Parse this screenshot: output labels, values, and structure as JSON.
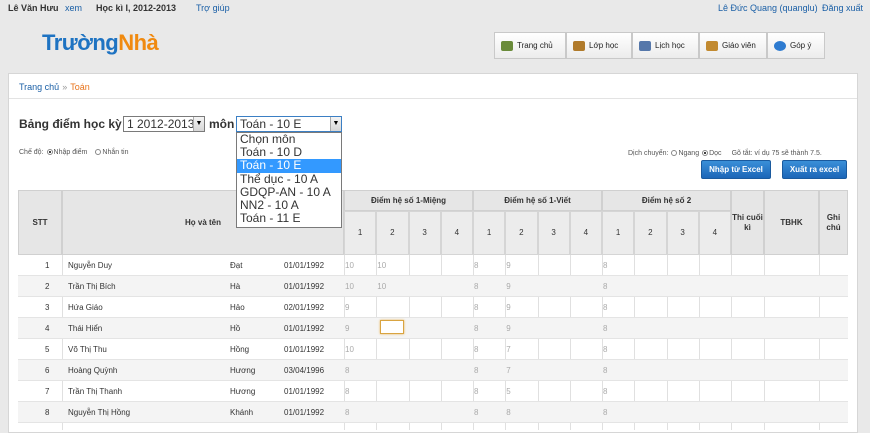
{
  "top": {
    "user": "Lê Văn Hưu",
    "view": "xem",
    "term": "Học kì I, 2012-2013",
    "help": "Trợ giúp",
    "account": "Lê Đức Quang (quanglu)",
    "logout": "Đăng xuất"
  },
  "logo": {
    "part1": "Trường",
    "part2": "Nhà"
  },
  "nav": [
    {
      "label": "Trang chủ",
      "icon": "home-icon",
      "color": "#6a8b3a"
    },
    {
      "label": "Lớp học",
      "icon": "class-icon",
      "color": "#b07a2a"
    },
    {
      "label": "Lịch học",
      "icon": "calendar-icon",
      "color": "#5577aa"
    },
    {
      "label": "Giáo viên",
      "icon": "teacher-icon",
      "color": "#c28a30"
    },
    {
      "label": "Góp ý",
      "icon": "feedback-icon",
      "color": "#2e7bd0"
    }
  ],
  "breadcrumb": {
    "home": "Trang chủ",
    "sep": "»",
    "current": "Toán"
  },
  "form": {
    "title": "Bảng điểm học kỳ",
    "term_value": "1 2012-2013",
    "subject_label": "môn",
    "subject_value": "Toán - 10 E"
  },
  "dropdown": {
    "options": [
      "Chọn môn",
      "Toán - 10 D",
      "Toán - 10 E",
      "Thể dục - 10 A",
      "GDQP-AN - 10 A",
      "NN2 - 10 A",
      "Toán - 11 E"
    ],
    "selected": "Toán - 10 E"
  },
  "mode": {
    "label": "Chế độ:",
    "enter": "Nhập điểm",
    "message": "Nhắn tin",
    "selected": "Nhập điểm"
  },
  "direction": {
    "label": "Dịch chuyển:",
    "horizontal": "Ngang",
    "vertical": "Dọc",
    "selected": "Dọc"
  },
  "hint": "Gõ tắt: ví dụ 75 sẽ thành 7.5.",
  "buttons": {
    "import": "Nhập từ Excel",
    "export": "Xuất ra excel"
  },
  "accent": "#2a7ccc",
  "table": {
    "headers": {
      "stt": "STT",
      "name": "Họ và tên",
      "oral": "Điểm hệ số 1-Miệng",
      "written": "Điểm hệ số 1-Viết",
      "coef2": "Điểm hệ số 2",
      "final": "Thi cuối kì",
      "avg": "TBHK",
      "note": "Ghi chú"
    },
    "subcols": [
      "1",
      "2",
      "3",
      "4"
    ],
    "rows": [
      {
        "stt": "1",
        "last": "Nguyễn Duy",
        "first": "Đạt",
        "dob": "01/01/1992",
        "m": [
          "10",
          "10",
          "",
          ""
        ],
        "v": [
          "8",
          "9",
          "",
          ""
        ],
        "c": [
          "8",
          "",
          "",
          ""
        ]
      },
      {
        "stt": "2",
        "last": "Trần Thị Bích",
        "first": "Hà",
        "dob": "01/01/1992",
        "m": [
          "10",
          "10",
          "",
          ""
        ],
        "v": [
          "8",
          "9",
          "",
          ""
        ],
        "c": [
          "8",
          "",
          "",
          ""
        ]
      },
      {
        "stt": "3",
        "last": "Hứa Giáo",
        "first": "Hảo",
        "dob": "02/01/1992",
        "m": [
          "9",
          "",
          "",
          ""
        ],
        "v": [
          "8",
          "9",
          "",
          ""
        ],
        "c": [
          "8",
          "",
          "",
          ""
        ]
      },
      {
        "stt": "4",
        "last": "Thái Hiển",
        "first": "Hồ",
        "dob": "01/01/1992",
        "m": [
          "9",
          "",
          "",
          ""
        ],
        "v": [
          "8",
          "9",
          "",
          ""
        ],
        "c": [
          "8",
          "",
          "",
          ""
        ]
      },
      {
        "stt": "5",
        "last": "Võ Thị Thu",
        "first": "Hồng",
        "dob": "01/01/1992",
        "m": [
          "10",
          "",
          "",
          ""
        ],
        "v": [
          "8",
          "7",
          "",
          ""
        ],
        "c": [
          "8",
          "",
          "",
          ""
        ]
      },
      {
        "stt": "6",
        "last": "Hoàng Quỳnh",
        "first": "Hương",
        "dob": "03/04/1996",
        "m": [
          "8",
          "",
          "",
          ""
        ],
        "v": [
          "8",
          "7",
          "",
          ""
        ],
        "c": [
          "8",
          "",
          "",
          ""
        ]
      },
      {
        "stt": "7",
        "last": "Trần Thị Thanh",
        "first": "Hương",
        "dob": "01/01/1992",
        "m": [
          "8",
          "",
          "",
          ""
        ],
        "v": [
          "8",
          "5",
          "",
          ""
        ],
        "c": [
          "8",
          "",
          "",
          ""
        ]
      },
      {
        "stt": "8",
        "last": "Nguyễn Thị Hồng",
        "first": "Khánh",
        "dob": "01/01/1992",
        "m": [
          "8",
          "",
          "",
          ""
        ],
        "v": [
          "8",
          "8",
          "",
          ""
        ],
        "c": [
          "8",
          "",
          "",
          ""
        ]
      }
    ]
  }
}
